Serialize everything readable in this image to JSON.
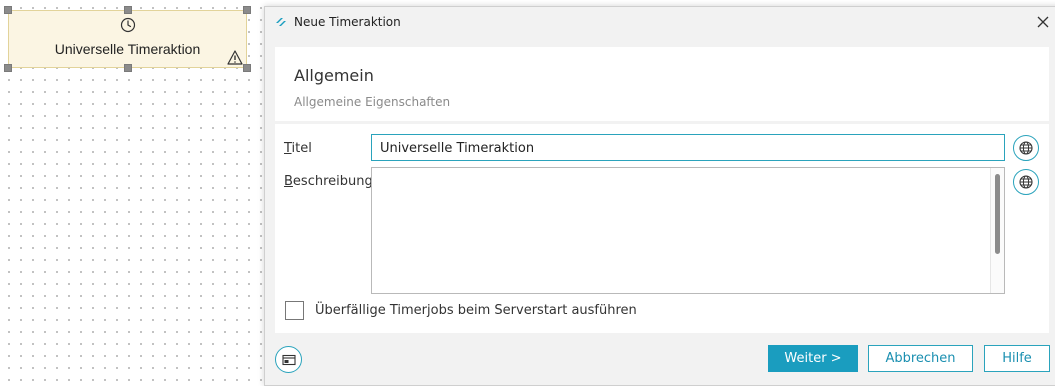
{
  "canvas": {
    "node": {
      "label": "Universelle Timeraktion",
      "icon": "clock-icon",
      "warning_icon": "warning-icon",
      "selected": true
    }
  },
  "dialog": {
    "title": "Neue Timeraktion",
    "header": {
      "title": "Allgemein",
      "subtitle": "Allgemeine Eigenschaften"
    },
    "fields": {
      "title": {
        "label_accel": "T",
        "label_rest": "itel",
        "value": "Universelle Timeraktion"
      },
      "description": {
        "label_accel": "B",
        "label_rest": "eschreibung",
        "value": ""
      }
    },
    "checkbox": {
      "label": "Überfällige Timerjobs beim Serverstart ausführen",
      "checked": false
    },
    "buttons": {
      "next": "Weiter >",
      "cancel": "Abbrechen",
      "help": "Hilfe"
    }
  },
  "colors": {
    "accent": "#1a9dbf",
    "node_bg": "#fbf5e3",
    "node_border": "#e2d39a"
  }
}
